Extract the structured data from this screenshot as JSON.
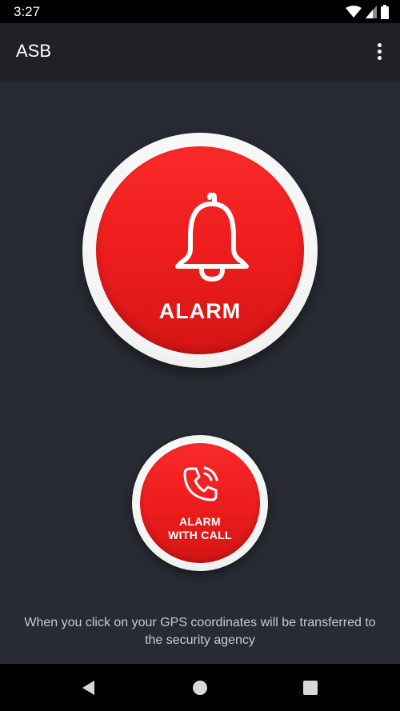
{
  "status_bar": {
    "time": "3:27",
    "icons": [
      "wifi-icon",
      "cell-signal-icon",
      "battery-icon"
    ]
  },
  "app_bar": {
    "title": "ASB",
    "menu_icon": "more-vert-icon"
  },
  "alarm_button": {
    "label": "ALARM",
    "icon": "bell-icon"
  },
  "alarm_call_button": {
    "label_line1": "ALARM",
    "label_line2": "WITH CALL",
    "icon": "phone-icon"
  },
  "info": {
    "text": "When you click on your GPS coordinates will be transferred to the security agency"
  },
  "nav_bar": {
    "buttons": [
      "back-icon",
      "home-icon",
      "recents-icon"
    ]
  },
  "colors": {
    "background": "#282b33",
    "app_bar": "#1f2126",
    "accent_red": "#ec1c1c",
    "ring_white": "#f4f4f4"
  }
}
